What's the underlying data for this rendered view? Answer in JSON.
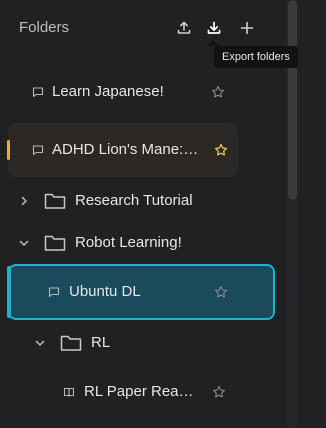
{
  "header": {
    "title": "Folders",
    "upload_icon": "upload-icon",
    "download_icon": "download-icon",
    "add_icon": "plus-icon"
  },
  "tooltip": {
    "text": "Export folders"
  },
  "items": [
    {
      "label": "Learn Japanese!",
      "type": "chat",
      "starred": false
    },
    {
      "label": "ADHD Lion's Mane: Mood Benefits",
      "type": "chat",
      "starred": true
    },
    {
      "label": "Research Tutorial",
      "type": "folder",
      "expanded": false
    },
    {
      "label": "Robot Learning!",
      "type": "folder",
      "expanded": true
    },
    {
      "label": "Ubuntu DL",
      "type": "chat",
      "starred": false,
      "selected": true
    },
    {
      "label": "RL",
      "type": "folder",
      "expanded": true
    },
    {
      "label": "RL Paper Reading",
      "type": "chat-book",
      "starred": false
    }
  ],
  "colors": {
    "background": "#202123",
    "accent_orange": "#f0a93a",
    "accent_cyan": "#1fb2cf",
    "selected_bg": "#1a4a5b",
    "star_gold": "#f2c94c"
  }
}
